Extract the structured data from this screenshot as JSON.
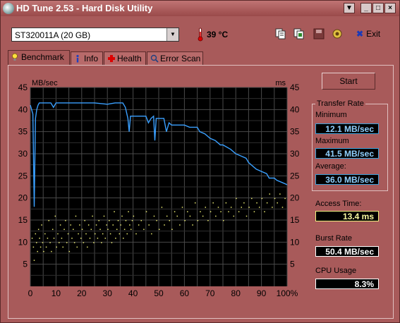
{
  "window": {
    "title": "HD Tune 2.53 - Hard Disk Utility",
    "controls": [
      "▼",
      "_",
      "□",
      "×"
    ]
  },
  "toolbar": {
    "drive": "ST320011A (20 GB)",
    "temperature": "39 °C",
    "exit_label": "Exit",
    "icons": [
      "copy-icon",
      "copy-all-icon",
      "save-icon",
      "options-icon"
    ]
  },
  "tabs": [
    {
      "label": "Benchmark",
      "icon": "lightbulb-icon",
      "active": true
    },
    {
      "label": "Info",
      "icon": "info-icon",
      "active": false
    },
    {
      "label": "Health",
      "icon": "health-cross-icon",
      "active": false
    },
    {
      "label": "Error Scan",
      "icon": "scan-icon",
      "active": false
    }
  ],
  "benchmark": {
    "start_label": "Start",
    "transfer_rate": {
      "title": "Transfer Rate",
      "min_label": "Minimum",
      "min_value": "12.1 MB/sec",
      "max_label": "Maximum",
      "max_value": "41.5 MB/sec",
      "avg_label": "Average:",
      "avg_value": "36.0 MB/sec"
    },
    "access_time": {
      "label": "Access Time:",
      "value": "13.4 ms"
    },
    "burst_rate": {
      "label": "Burst Rate",
      "value": "50.4 MB/sec"
    },
    "cpu_usage": {
      "label": "CPU Usage",
      "value": "8.3%"
    }
  },
  "colors": {
    "window_bg": "#a85a5a",
    "chart_bg": "#000000",
    "grid": "#4a4a4a",
    "transfer_line": "#3aa0ff",
    "access_points": "#e8e870"
  },
  "chart_data": {
    "type": "line",
    "y_left_label": "MB/sec",
    "y_right_label": "ms",
    "ylim": [
      0,
      45
    ],
    "xlim": [
      0,
      100
    ],
    "y_ticks": [
      5,
      10,
      15,
      20,
      25,
      30,
      35,
      40,
      45
    ],
    "x_ticks": [
      "0",
      "10",
      "20",
      "30",
      "40",
      "50",
      "60",
      "70",
      "80",
      "90",
      "100%"
    ],
    "grid": true,
    "series": [
      {
        "x": [
          0,
          1,
          1.5,
          2,
          2.5,
          3,
          3.5,
          4,
          8,
          9,
          10,
          15,
          20,
          25,
          30,
          33,
          35,
          36,
          37,
          38,
          38.5,
          39,
          40,
          45,
          46,
          47,
          48,
          48.5,
          49,
          50,
          52,
          53,
          54,
          55,
          56,
          58,
          60,
          62,
          65,
          66,
          68,
          70,
          72,
          74,
          75,
          78,
          80,
          82,
          84,
          85,
          88,
          90,
          92,
          93,
          95,
          96,
          98,
          100
        ],
        "y": [
          41,
          39,
          18,
          38,
          40,
          41,
          41.5,
          41.5,
          41.5,
          40.5,
          41.5,
          41.5,
          41.5,
          41.5,
          41.2,
          41.5,
          41.5,
          41.5,
          40.5,
          38,
          35,
          38.5,
          38.5,
          38.5,
          37,
          38,
          38.5,
          33,
          38,
          38,
          38,
          35,
          37,
          36.5,
          36.5,
          36.5,
          36.5,
          36,
          36,
          35,
          34.5,
          33.5,
          33,
          32,
          32,
          31,
          30,
          29.5,
          29,
          28,
          26.5,
          26,
          25.5,
          24.5,
          24.5,
          24,
          23.5,
          23
        ]
      },
      {
        "x": [
          0.5,
          1,
          1.3,
          1.8,
          2.2,
          2.6,
          3,
          3.4,
          3.8,
          4.2,
          4.6,
          5,
          5.5,
          6,
          6.5,
          7,
          7.5,
          8,
          8.5,
          9,
          9.5,
          10,
          10.5,
          11,
          11.5,
          12,
          12.5,
          13,
          13.5,
          14,
          14.5,
          15,
          15.5,
          16,
          16.5,
          17,
          17.5,
          18,
          18.5,
          19,
          19.5,
          20,
          20.5,
          21,
          21.5,
          22,
          22.5,
          23,
          23.5,
          24,
          24.5,
          25,
          25.5,
          26,
          26.5,
          27,
          27.5,
          28,
          28.5,
          29,
          29.5,
          30,
          30.5,
          31,
          31.5,
          32,
          32.5,
          33,
          33.5,
          34,
          34.5,
          35,
          35.5,
          36,
          36.5,
          37,
          37.5,
          38,
          38.5,
          39,
          39.5,
          40,
          41,
          42,
          43,
          44,
          45,
          46,
          47,
          48,
          49,
          50,
          51,
          52,
          53,
          54,
          55,
          56,
          57,
          58,
          59,
          60,
          61,
          62,
          63,
          64,
          65,
          66,
          67,
          68,
          69,
          70,
          71,
          72,
          73,
          74,
          75,
          76,
          77,
          78,
          79,
          80,
          81,
          82,
          83,
          84,
          85,
          86,
          87,
          88,
          89,
          90,
          91,
          92,
          93,
          94,
          95,
          96,
          97,
          98,
          99
        ],
        "y": [
          11,
          9,
          6,
          12,
          10,
          8,
          13,
          11,
          9,
          14,
          10,
          8,
          12,
          9,
          11,
          15,
          10,
          8,
          13,
          11,
          16,
          9,
          12,
          10,
          14,
          11,
          9,
          13,
          15,
          10,
          12,
          8,
          14,
          11,
          13,
          10,
          16,
          9,
          12,
          14,
          11,
          13,
          10,
          15,
          12,
          9,
          14,
          11,
          13,
          16,
          10,
          12,
          14,
          11,
          15,
          13,
          10,
          12,
          16,
          11,
          14,
          13,
          15,
          12,
          10,
          14,
          17,
          11,
          13,
          15,
          12,
          14,
          16,
          11,
          13,
          15,
          12,
          17,
          14,
          13,
          15,
          16,
          12,
          14,
          15,
          13,
          17,
          14,
          12,
          16,
          15,
          13,
          18,
          14,
          16,
          15,
          13,
          17,
          16,
          14,
          18,
          15,
          17,
          16,
          14,
          19,
          15,
          17,
          16,
          18,
          15,
          17,
          19,
          16,
          18,
          17,
          15,
          19,
          17,
          18,
          16,
          20,
          17,
          18,
          19,
          16,
          18,
          20,
          17,
          19,
          18,
          20,
          17,
          19,
          21,
          18,
          20,
          19,
          21,
          18,
          20
        ]
      }
    ]
  }
}
